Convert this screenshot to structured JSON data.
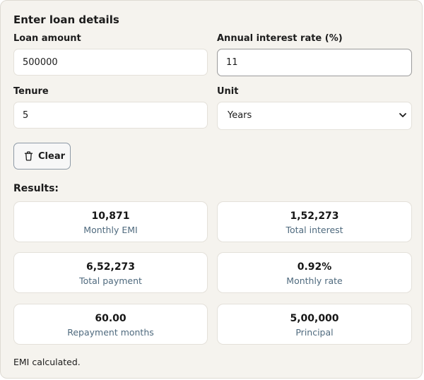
{
  "form": {
    "heading": "Enter loan details",
    "loan_amount": {
      "label": "Loan amount",
      "value": "500000"
    },
    "interest_rate": {
      "label": "Annual interest rate (%)",
      "value": "11"
    },
    "tenure": {
      "label": "Tenure",
      "value": "5"
    },
    "unit": {
      "label": "Unit",
      "selected": "Years"
    },
    "clear_label": "Clear"
  },
  "results": {
    "heading": "Results:",
    "cards": [
      {
        "value": "10,871",
        "caption": "Monthly EMI"
      },
      {
        "value": "1,52,273",
        "caption": "Total interest"
      },
      {
        "value": "6,52,273",
        "caption": "Total payment"
      },
      {
        "value": "0.92%",
        "caption": "Monthly rate"
      },
      {
        "value": "60.00",
        "caption": "Repayment months"
      },
      {
        "value": "5,00,000",
        "caption": "Principal"
      }
    ]
  },
  "status": "EMI calculated.",
  "colors": {
    "panel_bg": "#f5f3ee",
    "caption": "#4f6a7e",
    "button_border": "#8e9aa6"
  },
  "icons": {
    "clear": "trash-icon",
    "unit_select": "chevron-down-icon"
  }
}
